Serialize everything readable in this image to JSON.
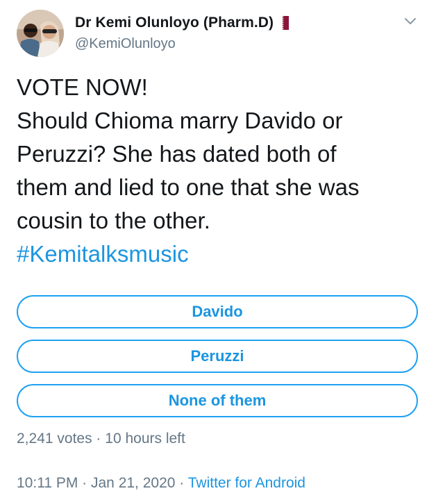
{
  "author": {
    "display_name": "Dr Kemi Olunloyo (Pharm.D)",
    "handle": "@KemiOlunloyo",
    "flag_icon": "qatar-flag",
    "avatar_icon": "profile-photo"
  },
  "tweet": {
    "lines": [
      "VOTE NOW!",
      "Should Chioma marry Davido or",
      "Peruzzi? She has dated both of",
      "them and lied to one that she was",
      "cousin to the other."
    ],
    "hashtag": "#Kemitalksmusic"
  },
  "poll": {
    "options": [
      "Davido",
      "Peruzzi",
      "None of them"
    ],
    "votes": "2,241 votes",
    "separator": " · ",
    "time_left": "10 hours left"
  },
  "meta": {
    "time": "10:11 PM",
    "sep1": " · ",
    "date": "Jan 21, 2020",
    "sep2": " · ",
    "client": "Twitter for Android"
  },
  "colors": {
    "link": "#1b95e0",
    "border": "#1da1f2",
    "muted": "#657786",
    "text": "#14171a",
    "flag_maroon": "#8a1538"
  }
}
